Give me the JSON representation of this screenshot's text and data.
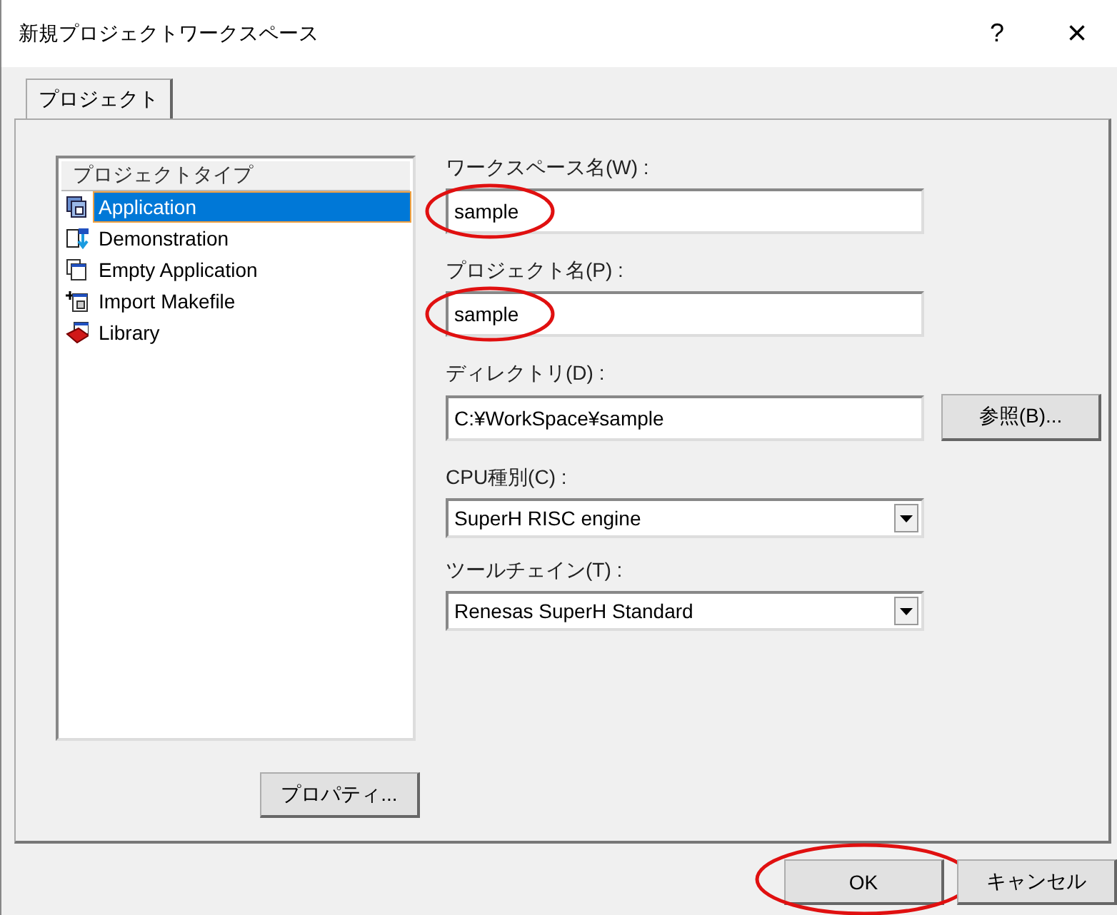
{
  "window": {
    "title": "新規プロジェクトワークスペース",
    "help": "?",
    "close": "×"
  },
  "tabs": [
    {
      "label": "プロジェクト",
      "selected": true
    }
  ],
  "project_types": {
    "header": "プロジェクトタイプ",
    "items": [
      {
        "label": "Application",
        "selected": true
      },
      {
        "label": "Demonstration",
        "selected": false
      },
      {
        "label": "Empty Application",
        "selected": false
      },
      {
        "label": "Import Makefile",
        "selected": false
      },
      {
        "label": "Library",
        "selected": false
      }
    ]
  },
  "properties_button": "プロパティ...",
  "fields": [
    {
      "kind": "text",
      "label": "ワークスペース名(W) :",
      "value": "sample",
      "circled": true
    },
    {
      "kind": "text",
      "label": "プロジェクト名(P) :",
      "value": "sample",
      "circled": true
    },
    {
      "kind": "browse",
      "label": "ディレクトリ(D) :",
      "value": "C:¥WorkSpace¥sample",
      "button": "参照(B)...",
      "circled": false
    },
    {
      "kind": "combo",
      "label": "CPU種別(C) :",
      "value": "SuperH RISC engine",
      "circled": false
    },
    {
      "kind": "combo",
      "label": "ツールチェイン(T) :",
      "value": "Renesas SuperH Standard",
      "circled": false
    }
  ],
  "buttons": [
    {
      "label": "OK",
      "circled": true
    },
    {
      "label": "キャンセル",
      "circled": false
    }
  ]
}
